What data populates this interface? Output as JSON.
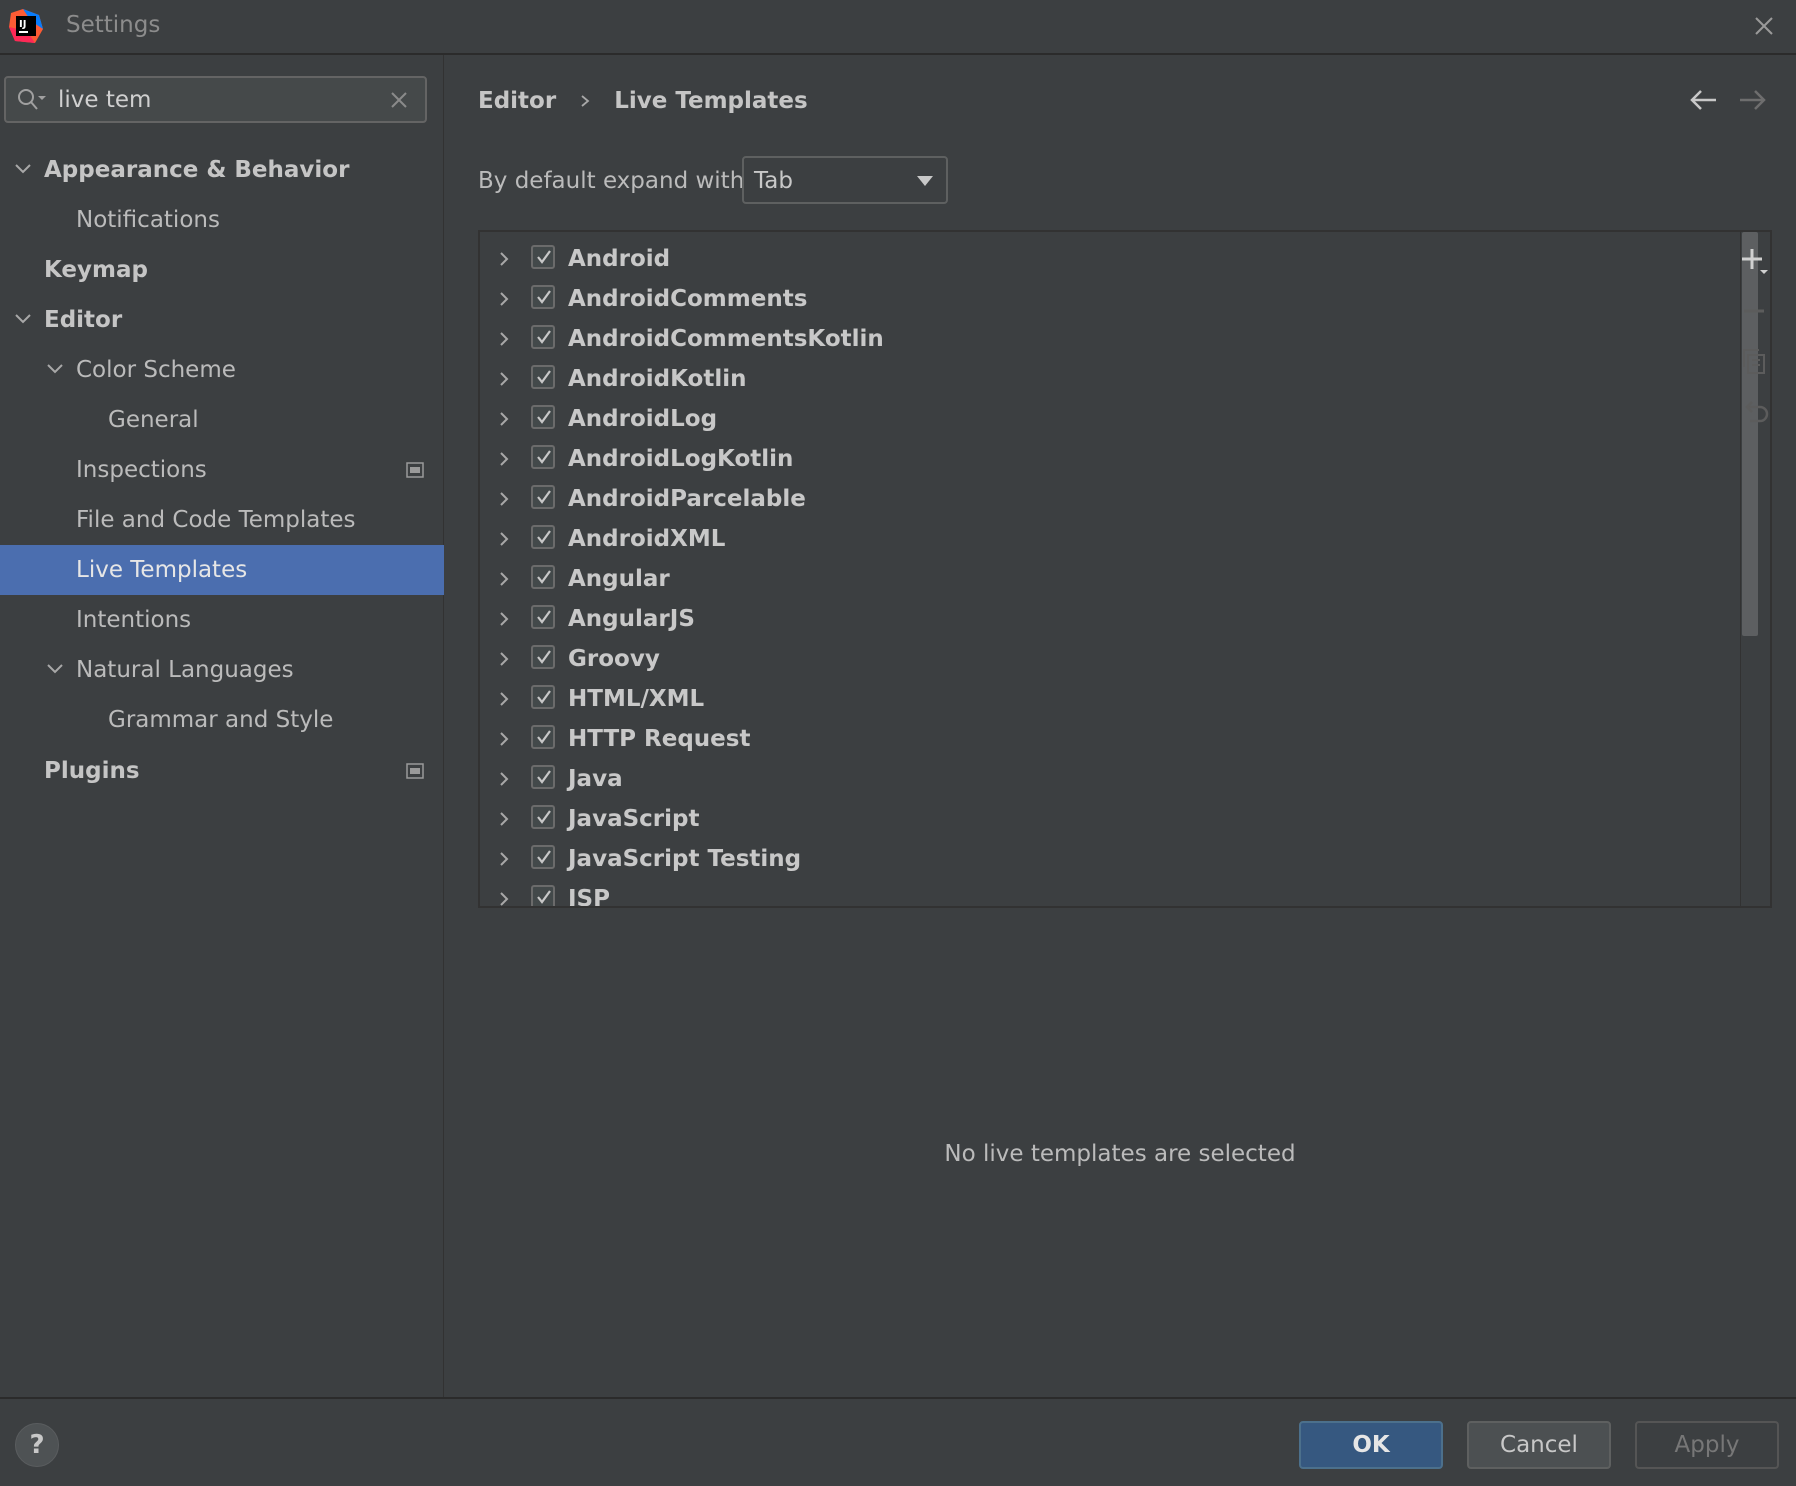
{
  "window": {
    "title": "Settings"
  },
  "search": {
    "value": "live tem"
  },
  "sidebar": {
    "items": [
      {
        "label": "Appearance & Behavior",
        "level": 0,
        "expanded": true,
        "bold": true
      },
      {
        "label": "Notifications",
        "level": 1
      },
      {
        "label": "Keymap",
        "level": 0,
        "bold": true
      },
      {
        "label": "Editor",
        "level": 0,
        "expanded": true,
        "bold": true
      },
      {
        "label": "Color Scheme",
        "level": 1,
        "expanded": true
      },
      {
        "label": "General",
        "level": 2
      },
      {
        "label": "Inspections",
        "level": 1,
        "badge": true
      },
      {
        "label": "File and Code Templates",
        "level": 1
      },
      {
        "label": "Live Templates",
        "level": 1,
        "selected": true
      },
      {
        "label": "Intentions",
        "level": 1
      },
      {
        "label": "Natural Languages",
        "level": 1,
        "expanded": true
      },
      {
        "label": "Grammar and Style",
        "level": 2
      },
      {
        "label": "Plugins",
        "level": 0,
        "bold": true,
        "badge": true
      }
    ]
  },
  "breadcrumb": {
    "parent": "Editor",
    "current": "Live Templates"
  },
  "expand": {
    "label": "By default expand with",
    "value": "Tab"
  },
  "templates": [
    {
      "name": "Android",
      "checked": true
    },
    {
      "name": "AndroidComments",
      "checked": true
    },
    {
      "name": "AndroidCommentsKotlin",
      "checked": true
    },
    {
      "name": "AndroidKotlin",
      "checked": true
    },
    {
      "name": "AndroidLog",
      "checked": true
    },
    {
      "name": "AndroidLogKotlin",
      "checked": true
    },
    {
      "name": "AndroidParcelable",
      "checked": true
    },
    {
      "name": "AndroidXML",
      "checked": true
    },
    {
      "name": "Angular",
      "checked": true
    },
    {
      "name": "AngularJS",
      "checked": true
    },
    {
      "name": "Groovy",
      "checked": true
    },
    {
      "name": "HTML/XML",
      "checked": true
    },
    {
      "name": "HTTP Request",
      "checked": true
    },
    {
      "name": "Java",
      "checked": true
    },
    {
      "name": "JavaScript",
      "checked": true
    },
    {
      "name": "JavaScript Testing",
      "checked": true
    },
    {
      "name": "JSP",
      "checked": true
    }
  ],
  "empty_message": "No live templates are selected",
  "footer": {
    "help": "?",
    "ok": "OK",
    "cancel": "Cancel",
    "apply": "Apply"
  },
  "colors": {
    "selection": "#4b6eaf",
    "ok_button": "#365880",
    "background": "#3c3f41"
  }
}
